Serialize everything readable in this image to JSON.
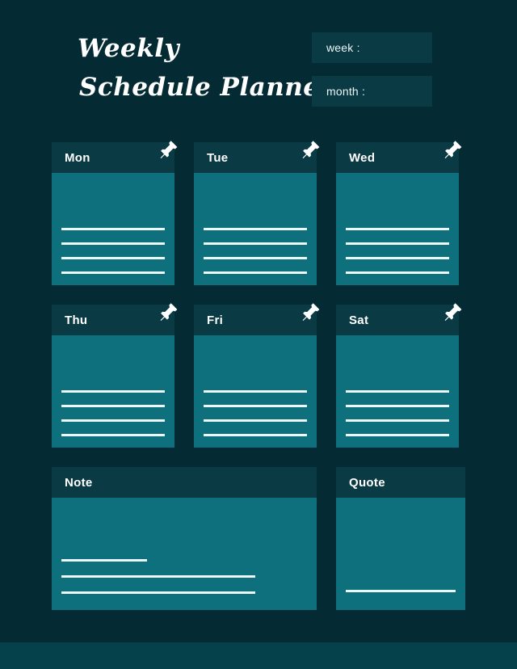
{
  "theme": {
    "background": "#042a33",
    "card_header": "#0a3a44",
    "card_body": "#0e6f7d",
    "rule": "#ecf7f8",
    "text": "#ffffff",
    "footer_band": "#04414b"
  },
  "header": {
    "title_line_1": "Weekly",
    "title_line_2": "Schedule Planner",
    "fields": [
      {
        "name": "week",
        "label": "week :",
        "value": ""
      },
      {
        "name": "month",
        "label": "month :",
        "value": ""
      }
    ]
  },
  "cards": {
    "days": [
      {
        "label": "Mon",
        "pin_icon": "push-pin-icon",
        "line_count": 4,
        "content": ""
      },
      {
        "label": "Tue",
        "pin_icon": "push-pin-icon",
        "line_count": 4,
        "content": ""
      },
      {
        "label": "Wed",
        "pin_icon": "push-pin-icon",
        "line_count": 4,
        "content": ""
      },
      {
        "label": "Thu",
        "pin_icon": "push-pin-icon",
        "line_count": 4,
        "content": ""
      },
      {
        "label": "Fri",
        "pin_icon": "push-pin-icon",
        "line_count": 4,
        "content": ""
      },
      {
        "label": "Sat",
        "pin_icon": "push-pin-icon",
        "line_count": 4,
        "content": ""
      }
    ],
    "note": {
      "label": "Note",
      "line_count": 3,
      "content": ""
    },
    "quote": {
      "label": "Quote",
      "line_count": 1,
      "content": ""
    }
  }
}
